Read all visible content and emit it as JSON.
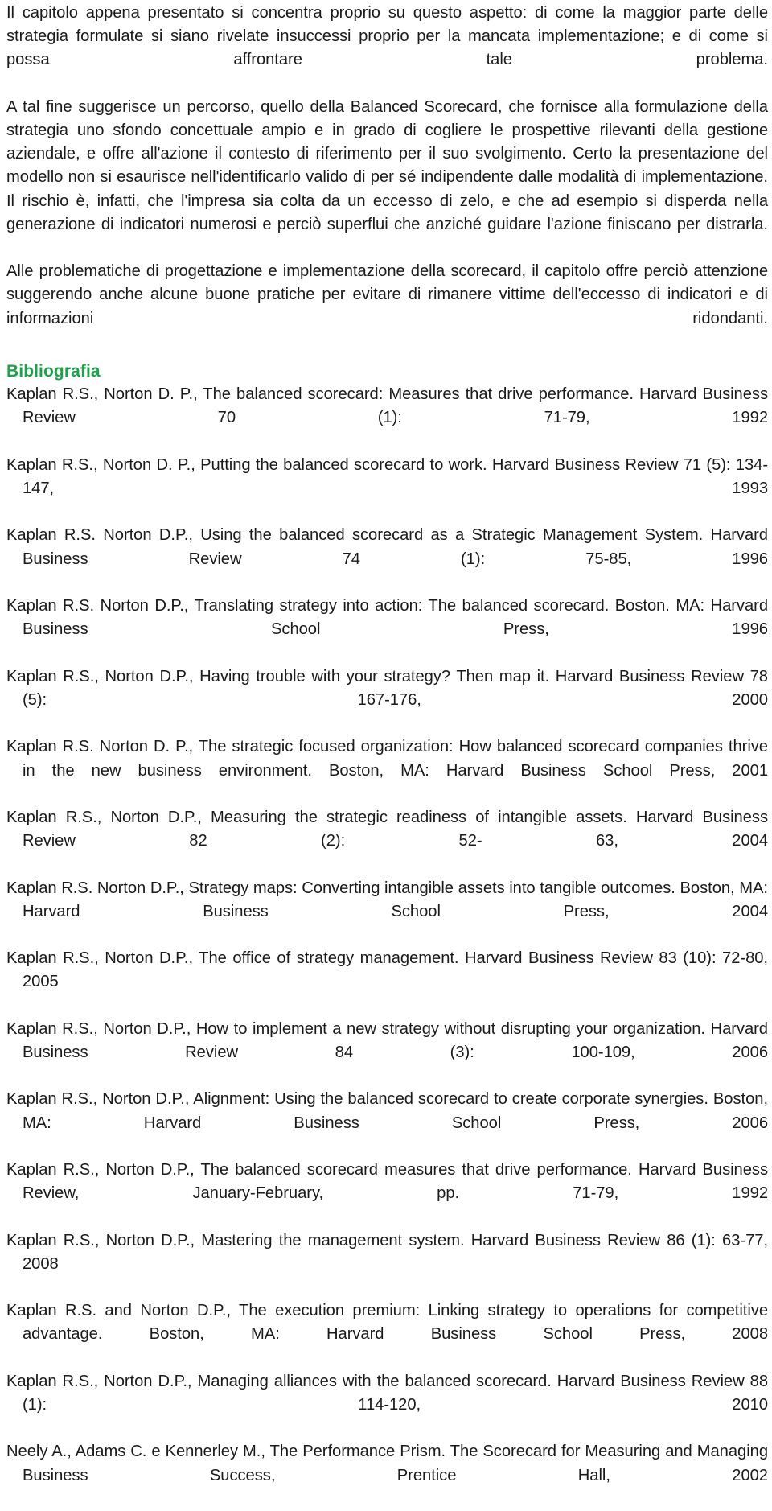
{
  "document": {
    "language": "it",
    "colors": {
      "text": "#1a1a1a",
      "heading_accent": "#1FA04B",
      "background": "#ffffff"
    },
    "body_paragraphs": [
      "Il capitolo appena presentato si concentra proprio su questo aspetto: di come la maggior parte delle strategia formulate si siano rivelate insuccessi proprio per la mancata implementazione; e di come si possa affrontare tale problema.",
      "A tal fine suggerisce un percorso, quello della Balanced Scorecard, che fornisce alla formulazione della strategia uno sfondo concettuale ampio e in grado di cogliere le prospettive rilevanti della gestione aziendale, e offre all'azione il contesto di riferimento per il suo svolgimento. Certo la presentazione del modello non si esaurisce nell'identificarlo valido di per sé indipendente dalle modalità di implementazione. Il rischio è, infatti, che l'impresa sia colta da un eccesso di zelo, e che ad esempio si disperda nella generazione di indicatori numerosi e perciò superflui che anziché guidare l'azione finiscano per distrarla.",
      "Alle problematiche di progettazione e implementazione della scorecard, il capitolo offre perciò attenzione suggerendo anche alcune buone pratiche per evitare di rimanere vittime dell'eccesso di indicatori e di informazioni ridondanti."
    ],
    "bibliography": {
      "heading": "Bibliografia",
      "entries": [
        "Kaplan R.S., Norton D. P., The balanced scorecard: Measures that drive performance. Harvard Business Review 70 (1): 71-79, 1992",
        "Kaplan R.S., Norton D. P., Putting the balanced scorecard to work. Harvard Business Review 71 (5): 134-147, 1993",
        "Kaplan R.S. Norton D.P., Using the balanced scorecard as a Strategic Management System. Harvard Business Review 74 (1): 75-85, 1996",
        "Kaplan R.S. Norton D.P., Translating strategy into action: The balanced scorecard. Boston. MA: Harvard Business School Press, 1996",
        "Kaplan R.S., Norton D.P., Having trouble with your strategy? Then map it. Harvard Business Review 78 (5): 167-176, 2000",
        "Kaplan R.S. Norton D. P., The strategic focused organization: How balanced scorecard companies thrive in the new business environment. Boston, MA: Harvard Business School Press, 2001",
        "Kaplan R.S., Norton D.P., Measuring the strategic readiness of intangible assets. Harvard Business Review 82 (2): 52- 63, 2004",
        "Kaplan R.S. Norton D.P., Strategy maps: Converting intangible assets into tangible outcomes. Boston, MA: Harvard Business School Press, 2004",
        "Kaplan R.S., Norton D.P., The office of strategy management. Harvard Business Review 83 (10): 72-80, 2005",
        "Kaplan R.S., Norton D.P., How to implement a new strategy without disrupting your organization. Harvard Business Review 84 (3): 100-109, 2006",
        "Kaplan R.S., Norton D.P., Alignment: Using the balanced scorecard to create corporate synergies. Boston, MA: Harvard Business School Press, 2006",
        "Kaplan R.S., Norton D.P., The balanced scorecard measures that drive performance. Harvard Business Review, January-February, pp. 71-79, 1992",
        "Kaplan R.S., Norton D.P., Mastering the management system. Harvard Business Review 86 (1): 63-77, 2008",
        "Kaplan R.S. and Norton D.P., The execution premium: Linking strategy to operations for competitive advantage. Boston, MA: Harvard Business School Press, 2008",
        "Kaplan R.S., Norton D.P., Managing alliances with the balanced scorecard. Harvard Business Review 88 (1): 114-120, 2010",
        "Neely A., Adams C. e Kennerley M., The Performance Prism. The Scorecard for Measuring and Managing Business Success, Prentice Hall, 2002"
      ]
    }
  }
}
